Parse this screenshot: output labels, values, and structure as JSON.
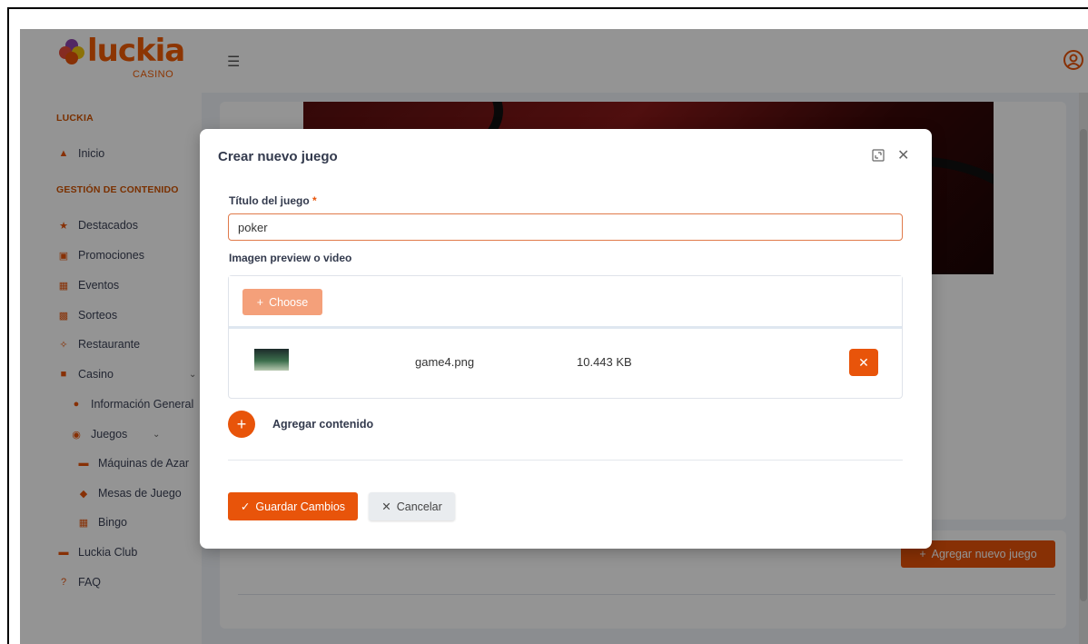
{
  "brand": {
    "name": "luckia",
    "sub": "CASINO"
  },
  "sidebar": {
    "section_main": "LUCKIA",
    "home": "Inicio",
    "section_content": "GESTIÓN DE CONTENIDO",
    "items": [
      {
        "label": "Destacados",
        "icon": "star-icon"
      },
      {
        "label": "Promociones",
        "icon": "promo-icon"
      },
      {
        "label": "Eventos",
        "icon": "calendar-icon"
      },
      {
        "label": "Sorteos",
        "icon": "gift-icon"
      },
      {
        "label": "Restaurante",
        "icon": "utensils-icon"
      },
      {
        "label": "Casino",
        "icon": "casino-icon"
      }
    ],
    "casino_sub": {
      "info": "Información General",
      "games": "Juegos",
      "games_sub": [
        "Máquinas de Azar",
        "Mesas de Juego",
        "Bingo"
      ]
    },
    "club": "Luckia Club",
    "faq": "FAQ"
  },
  "background": {
    "add_game_label": "Agregar nuevo juego"
  },
  "modal": {
    "title": "Crear nuevo juego",
    "title_field_label": "Título del juego",
    "required_mark": "*",
    "title_value": "poker",
    "media_label": "Imagen preview o video",
    "choose_label": "Choose",
    "file": {
      "name": "game4.png",
      "size": "10.443 KB"
    },
    "add_content_label": "Agregar contenido",
    "save_label": "Guardar Cambios",
    "cancel_label": "Cancelar"
  },
  "colors": {
    "accent": "#e8540a",
    "accent_light": "#f4a07a",
    "text": "#333a4d"
  }
}
